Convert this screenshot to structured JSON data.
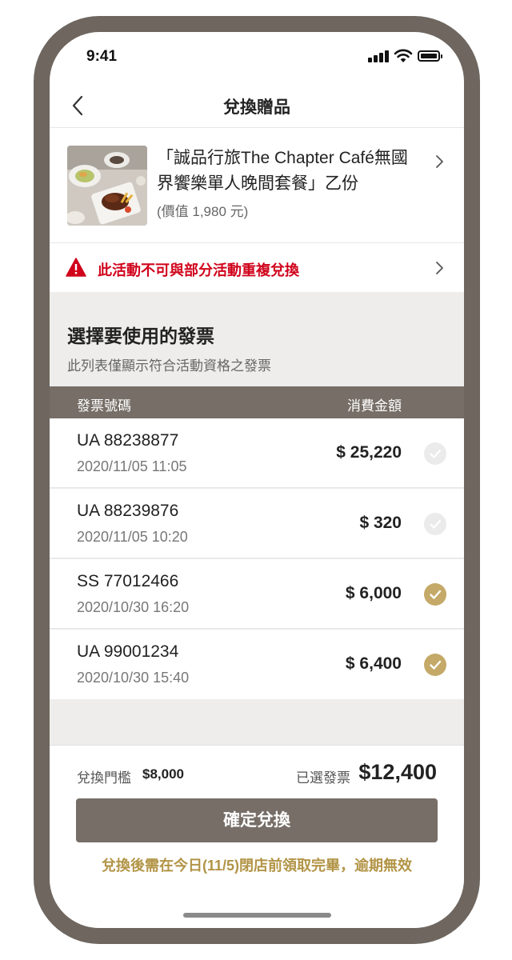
{
  "status_bar": {
    "time": "9:41",
    "icons": [
      "signal-icon",
      "wifi-icon",
      "battery-icon"
    ]
  },
  "nav": {
    "title": "兌換贈品",
    "back_icon": "chevron-left-icon"
  },
  "gift": {
    "title": "「誠品行旅The Chapter Café無國界饗樂單人晚間套餐」乙份",
    "value": "(價值 1,980 元)"
  },
  "warning": {
    "text": "此活動不可與部分活動重複兌換",
    "color": "#d0021b"
  },
  "invoice_section": {
    "title": "選擇要使用的發票",
    "subtitle": "此列表僅顯示符合活動資格之發票",
    "columns": [
      "發票號碼",
      "消費金額"
    ],
    "rows": [
      {
        "number": "UA 88238877",
        "datetime": "2020/11/05 11:05",
        "amount": "$ 25,220",
        "selected": false
      },
      {
        "number": "UA 88239876",
        "datetime": "2020/11/05 10:20",
        "amount": "$ 320",
        "selected": false
      },
      {
        "number": "SS 77012466",
        "datetime": "2020/10/30 16:20",
        "amount": "$ 6,000",
        "selected": true
      },
      {
        "number": "UA 99001234",
        "datetime": "2020/10/30 15:40",
        "amount": "$ 6,400",
        "selected": true
      }
    ]
  },
  "footer": {
    "threshold_label": "兌換門檻",
    "threshold_value": "$8,000",
    "selected_label": "已選發票",
    "selected_total": "$12,400",
    "confirm_label": "確定兌換",
    "notice": "兌換後需在今日(11/5)閉店前領取完畢，逾期無效"
  },
  "colors": {
    "frame": "#6e665f",
    "header_bar": "#766e67",
    "check_selected": "#c4a968",
    "notice": "#b29446"
  }
}
